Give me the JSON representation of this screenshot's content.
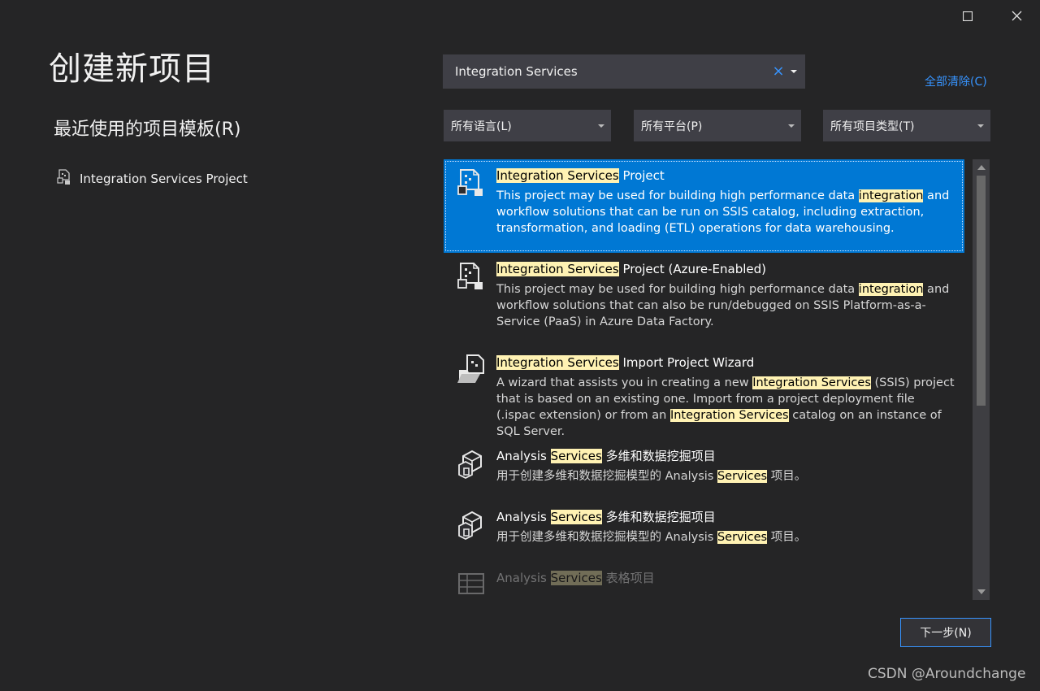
{
  "window": {
    "maximize_icon": "maximize-icon",
    "close_icon": "close-icon"
  },
  "page_title": "创建新项目",
  "recent": {
    "heading": "最近使用的项目模板(R)",
    "items": [
      {
        "label": "Integration Services Project",
        "icon": "ssis-project-icon"
      }
    ]
  },
  "search": {
    "value": "Integration Services",
    "clear_glyph": "×"
  },
  "clear_all": "全部清除(C)",
  "filters": {
    "language": "所有语言(L)",
    "platform": "所有平台(P)",
    "project_type": "所有项目类型(T)"
  },
  "templates": [
    {
      "title_pre": "",
      "title_hl": "Integration Services",
      "title_post": " Project",
      "icon": "ssis-project-icon",
      "selected": true,
      "desc": [
        {
          "t": "This project may be used for building high performance data ",
          "hl": false
        },
        {
          "t": "integration",
          "hl": true
        },
        {
          "t": " and workflow solutions that can be run on SSIS catalog, including extraction, transformation, and loading (ETL) operations for data warehousing.",
          "hl": false
        }
      ]
    },
    {
      "title_pre": "",
      "title_hl": "Integration Services",
      "title_post": " Project (Azure-Enabled)",
      "icon": "ssis-project-icon",
      "selected": false,
      "desc": [
        {
          "t": "This project may be used for building high performance data ",
          "hl": false
        },
        {
          "t": "integration",
          "hl": true
        },
        {
          "t": " and workflow solutions that can also be run/debugged on SSIS Platform-as-a-Service (PaaS) in Azure Data Factory.",
          "hl": false
        }
      ]
    },
    {
      "title_pre": "",
      "title_hl": "Integration Services",
      "title_post": " Import Project Wizard",
      "icon": "import-wizard-icon",
      "selected": false,
      "desc": [
        {
          "t": "A wizard that assists you in creating a new ",
          "hl": false
        },
        {
          "t": "Integration Services",
          "hl": true
        },
        {
          "t": " (SSIS) project that is based on an existing one. Import from a project deployment file (.ispac extension) or from an ",
          "hl": false
        },
        {
          "t": "Integration Services",
          "hl": true
        },
        {
          "t": " catalog on an instance of SQL Server.",
          "hl": false
        }
      ]
    },
    {
      "title_pre": "Analysis ",
      "title_hl": "Services",
      "title_post": " 多维和数据挖掘项目",
      "icon": "analysis-cube-icon",
      "selected": false,
      "desc": [
        {
          "t": "用于创建多维和数据挖掘模型的 Analysis ",
          "hl": false
        },
        {
          "t": "Services",
          "hl": true
        },
        {
          "t": " 项目。",
          "hl": false
        }
      ]
    },
    {
      "title_pre": "Analysis ",
      "title_hl": "Services",
      "title_post": " 多维和数据挖掘项目",
      "icon": "analysis-cube-icon",
      "selected": false,
      "desc": [
        {
          "t": "用于创建多维和数据挖掘模型的 Analysis ",
          "hl": false
        },
        {
          "t": "Services",
          "hl": true
        },
        {
          "t": " 项目。",
          "hl": false
        }
      ]
    },
    {
      "title_pre": "Analysis ",
      "title_hl": "Services",
      "title_post": " 表格项目",
      "icon": "analysis-tabular-icon",
      "selected": false,
      "faded": true,
      "desc": []
    }
  ],
  "next_button": "下一步(N)",
  "watermark": "CSDN @Aroundchange"
}
